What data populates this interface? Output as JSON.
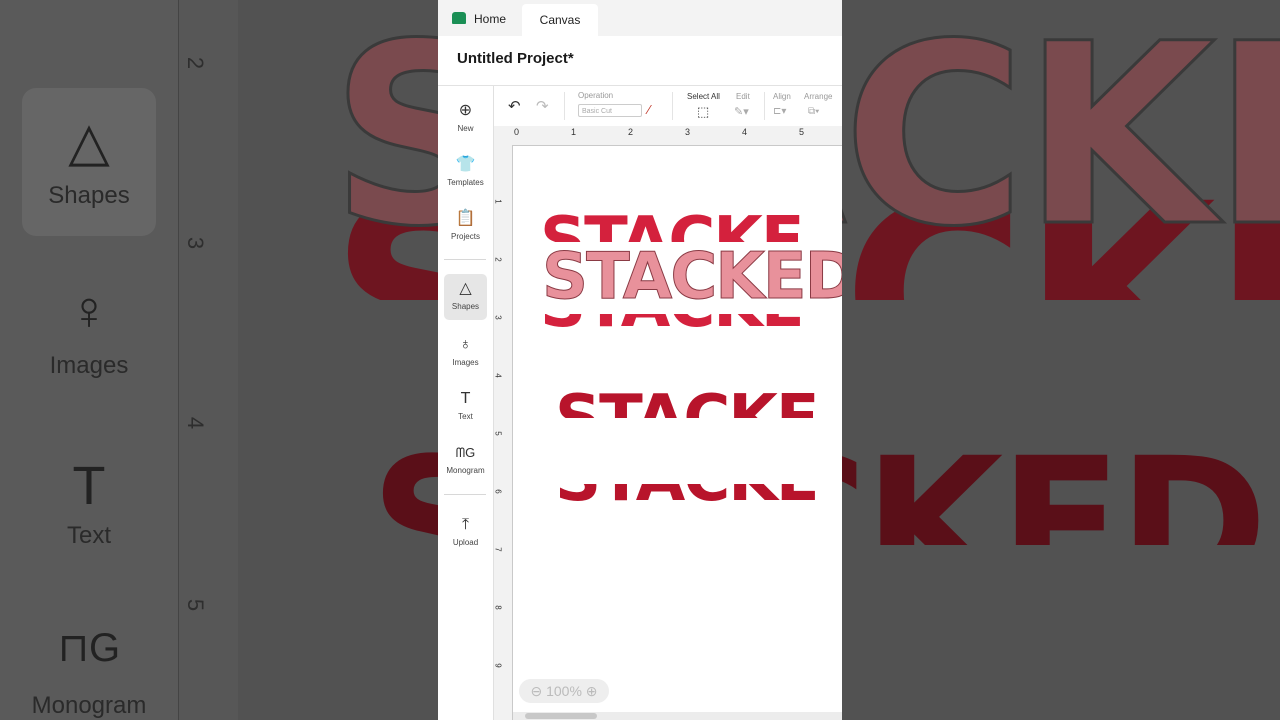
{
  "tabs": {
    "home": "Home",
    "canvas": "Canvas"
  },
  "project": {
    "title": "Untitled Project*"
  },
  "sidebar": {
    "items": [
      {
        "label": "New",
        "icon": "plus-circle-icon"
      },
      {
        "label": "Templates",
        "icon": "shirt-icon"
      },
      {
        "label": "Projects",
        "icon": "clipboard-icon"
      },
      {
        "label": "Shapes",
        "icon": "shapes-icon"
      },
      {
        "label": "Images",
        "icon": "balloon-icon"
      },
      {
        "label": "Text",
        "icon": "text-t-icon"
      },
      {
        "label": "Monogram",
        "icon": "monogram-icon"
      },
      {
        "label": "Upload",
        "icon": "upload-icon"
      }
    ]
  },
  "toolbar": {
    "operation_label": "Operation",
    "operation_value": "Basic Cut",
    "select_all": "Select All",
    "edit": "Edit",
    "align": "Align",
    "arrange": "Arrange"
  },
  "ruler": {
    "h": [
      "0",
      "1",
      "2",
      "3",
      "4",
      "5"
    ],
    "v": [
      "1",
      "2",
      "3",
      "4",
      "5",
      "6",
      "7",
      "8",
      "9"
    ]
  },
  "canvas": {
    "words": [
      "STACKED",
      "STACKED",
      "STACKED",
      "STACKED",
      "STACKED"
    ],
    "zoom": "100%"
  },
  "background": {
    "sidebar_labels": [
      "Shapes",
      "Images",
      "Text",
      "Monogram"
    ],
    "ruler_labels": [
      "2",
      "3",
      "4",
      "5"
    ],
    "word": "STACKED"
  },
  "colors": {
    "red": "#d4213d",
    "pink": "#e8919b",
    "dark_red": "#b8142b",
    "brand_green": "#1a8f55"
  }
}
